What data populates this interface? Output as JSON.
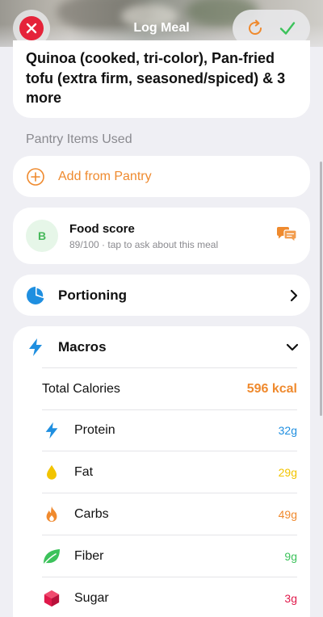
{
  "header": {
    "title": "Log Meal"
  },
  "meal": {
    "title": "Quinoa (cooked, tri-color), Pan-fried tofu (extra firm, seasoned/spiced) & 3 more"
  },
  "pantry": {
    "section_label": "Pantry Items Used",
    "add_label": "Add from Pantry"
  },
  "food_score": {
    "grade": "B",
    "title": "Food score",
    "subtitle": "89/100 · tap to ask about this meal"
  },
  "portioning": {
    "label": "Portioning"
  },
  "macros": {
    "label": "Macros",
    "total_label": "Total Calories",
    "total_value": "596 kcal",
    "items": [
      {
        "name": "Protein",
        "value": "32g",
        "color": "#1f8fe0",
        "icon": "bolt-icon"
      },
      {
        "name": "Fat",
        "value": "29g",
        "color": "#f2c400",
        "icon": "drop-icon"
      },
      {
        "name": "Carbs",
        "value": "49g",
        "color": "#f08a2e",
        "icon": "flame-icon"
      },
      {
        "name": "Fiber",
        "value": "9g",
        "color": "#3cc25b",
        "icon": "leaf-icon"
      },
      {
        "name": "Sugar",
        "value": "3g",
        "color": "#e0184a",
        "icon": "cube-icon"
      }
    ]
  },
  "colors": {
    "accent": "#ef8a2e",
    "close": "#e5233a",
    "confirm": "#3cc25b",
    "macro_icon": "#1f8fe0"
  }
}
